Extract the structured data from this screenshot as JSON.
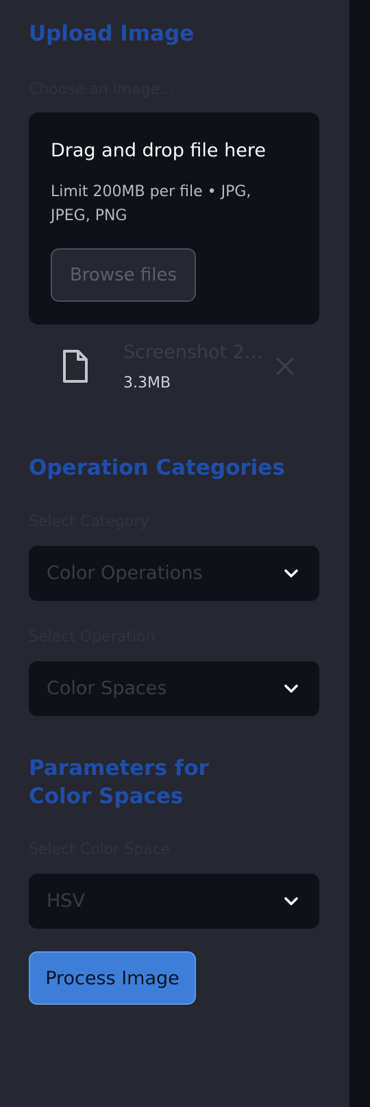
{
  "upload": {
    "title": "Upload Image",
    "label": "Choose an image...",
    "dropzone_title": "Drag and drop file here",
    "dropzone_limit": "Limit 200MB per file • JPG, JPEG, PNG",
    "browse_label": "Browse files",
    "file": {
      "name": "Screenshot 2…",
      "size": "3.3MB",
      "icon": "file-icon"
    }
  },
  "operations": {
    "title": "Operation Categories",
    "category_label": "Select Category",
    "category_value": "Color Operations",
    "operation_label": "Select Operation",
    "operation_value": "Color Spaces"
  },
  "parameters": {
    "title": "Parameters for Color Spaces",
    "color_space_label": "Select Color Space",
    "color_space_value": "HSV"
  },
  "actions": {
    "process_label": "Process Image"
  },
  "colors": {
    "sidebar_bg": "#262730",
    "main_bg": "#0e1117",
    "heading": "#1f4eaa",
    "primary": "#3d7fd8"
  }
}
